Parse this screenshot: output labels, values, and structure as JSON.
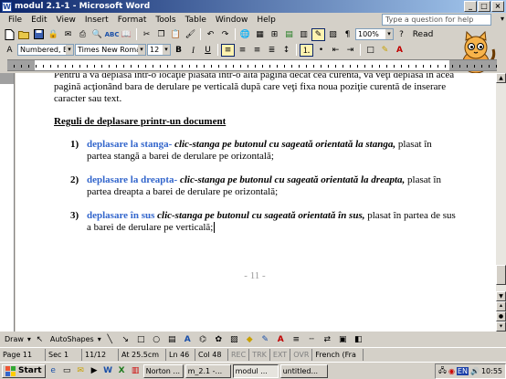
{
  "window": {
    "title": "modul 2.1-1 - Microsoft Word",
    "app_icon": "W"
  },
  "menu": [
    "File",
    "Edit",
    "View",
    "Insert",
    "Format",
    "Tools",
    "Table",
    "Window",
    "Help"
  ],
  "ask_placeholder": "Type a question for help",
  "toolbar": {
    "zoom": "100%",
    "read_label": "Read",
    "style": "Numbered, Bold",
    "font": "Times New Roman",
    "size": "12"
  },
  "document": {
    "intro": "Pentru a vă deplasa într-o locaţie plasată într-o altă pagină decât cea curentă, vă veţi deplasa în acea pagină acţionând bara de derulare pe verticală după care veţi fixa noua poziţie curentă de  inserare caracter sau text.",
    "heading": "Reguli de deplasare printr-un document",
    "items": [
      {
        "num": "1)",
        "term": "deplasare la stanga",
        "sep": "-",
        "action": " clic-stanga pe butonul cu sageată orientată la stanga,",
        "rest": " plasat în partea stangă a barei de derulare pe orizontală;"
      },
      {
        "num": "2)",
        "term": "deplasare la dreapta",
        "sep": "-",
        "action": " clic-stanga pe butonul cu sageată orientată la dreapta,",
        "rest": " plasat în partea dreapta a barei de derulare pe orizontală;"
      },
      {
        "num": "3)",
        "term": "deplasare în sus",
        "sep": "",
        "action": " clic-stanga pe butonul cu sageată orientată în sus,",
        "rest": " plasat în partea de sus a barei de derulare pe verticală;"
      }
    ],
    "page_number": "- 11 -"
  },
  "drawbar": {
    "draw": "Draw",
    "autoshapes": "AutoShapes"
  },
  "status": {
    "page": "Page  11",
    "sec": "Sec  1",
    "pages": "11/12",
    "at": "At  25.5cm",
    "ln": "Ln  46",
    "col": "Col  48",
    "rec": "REC",
    "trk": "TRK",
    "ext": "EXT",
    "ovr": "OVR",
    "lang": "French (Fra"
  },
  "taskbar": {
    "start": "Start",
    "tasks": [
      "Norton ...",
      "m_2.1 -...",
      "modul ...",
      "untitled..."
    ],
    "tray_lang": "EN",
    "clock": "10:55"
  },
  "colors": {
    "accent": "#0a246a",
    "link_blue": "#3366cc"
  }
}
